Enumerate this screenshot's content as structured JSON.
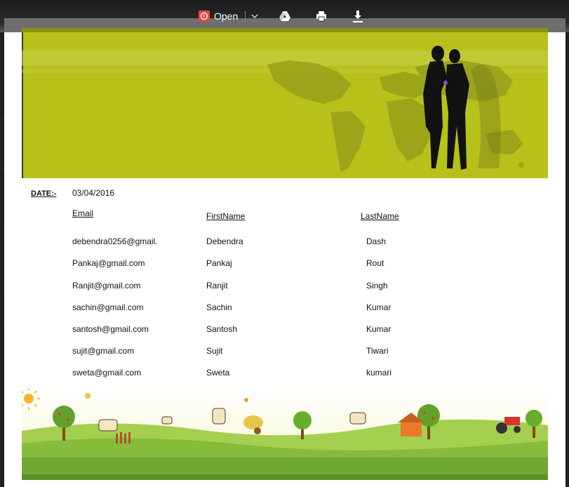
{
  "toolbar": {
    "open_label": "Open",
    "icons": [
      "open-with-app-icon",
      "chevron-down-icon",
      "google-drive-icon",
      "print-icon",
      "download-icon"
    ]
  },
  "document": {
    "date_label": "DATE:-",
    "date_value": "03/04/2016",
    "table": {
      "columns": [
        "Email",
        "FirstName",
        "LastName"
      ],
      "rows": [
        [
          "debendra0256@gmail.",
          "Debendra",
          "Dash"
        ],
        [
          "Pankaj@gmail.com",
          "Pankaj",
          "Rout"
        ],
        [
          "Ranjit@gmail.com",
          "Ranjit",
          "Singh"
        ],
        [
          "sachin@gmail.com",
          "Sachin",
          "Kumar"
        ],
        [
          "santosh@gmail.com",
          "Santosh",
          "Kumar"
        ],
        [
          "sujit@gmail.com",
          "Sujit",
          "Tiwari"
        ],
        [
          "sweta@gmail.com",
          "Sweta",
          "kumari"
        ]
      ]
    }
  },
  "colors": {
    "banner": "#b7c11a",
    "grass": "#7cb342",
    "app_icon": "#e24c3c"
  }
}
